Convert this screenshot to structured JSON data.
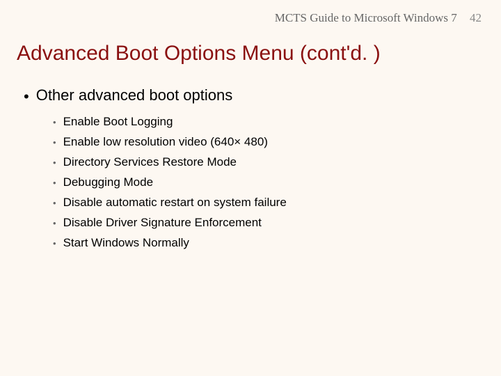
{
  "header": {
    "book_title": "MCTS Guide to Microsoft Windows 7",
    "page_number": "42"
  },
  "title": "Advanced Boot Options Menu (cont'd. )",
  "bullets": {
    "level1_text": "Other advanced boot options",
    "level2": [
      "Enable Boot Logging",
      "Enable low resolution video (640× 480)",
      "Directory Services Restore Mode",
      "Debugging Mode",
      "Disable automatic restart on system failure",
      "Disable Driver Signature Enforcement",
      "Start Windows Normally"
    ]
  }
}
